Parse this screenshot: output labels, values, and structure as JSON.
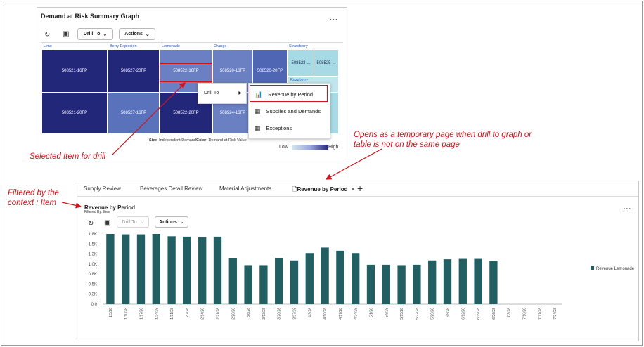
{
  "top": {
    "title": "Demand at Risk Summary Graph",
    "more": "...",
    "drill_label": "Drill To",
    "actions_label": "Actions",
    "categories": [
      "Lime",
      "Berry Explosion",
      "Lemonade",
      "Orange",
      "Strawberry",
      "Razzberry"
    ],
    "tiles": [
      "508521-16FP",
      "508527-20FP",
      "508522-16FP",
      "508520-16FP",
      "508520-20FP",
      "508523-...",
      "508525-...",
      "508521-20FP",
      "508527-16FP",
      "508522-20FP",
      "508524-16FP"
    ],
    "legend": {
      "size_label": "Size",
      "size_value": "Independent Demand",
      "color_label": "Color",
      "color_value": "Demand at Risk Value",
      "low": "Low",
      "high": "High"
    },
    "colors": {
      "dark": "#23277a",
      "mid": "#6a80c2",
      "light": "#a6dbe6"
    },
    "context_menu": {
      "drill_to": "Drill To"
    },
    "submenu": [
      "Revenue by Period",
      "Supplies and Demands",
      "Exceptions"
    ]
  },
  "annotations": {
    "selected": "Selected Item for drill",
    "opens": "Opens as a temporary page when drill to graph or table is not on the same page",
    "filtered": "Filtered by the context : Item"
  },
  "bottom": {
    "tabs": [
      "Supply Review",
      "Beverages Detail Review",
      "Material Adjustments",
      "Revenue by Period"
    ],
    "close": "×",
    "add": "+",
    "title": "Revenue by Period",
    "filter": "Filtered By: Item",
    "more": "...",
    "drill_label": "Drill To",
    "actions_label": "Actions"
  },
  "chart_data": {
    "type": "bar",
    "categories": [
      "1/3/28",
      "1/10/28",
      "1/17/28",
      "1/24/28",
      "1/31/28",
      "2/7/28",
      "2/14/28",
      "2/21/28",
      "2/28/28",
      "3/6/28",
      "3/13/28",
      "3/20/28",
      "3/27/28",
      "4/3/28",
      "4/10/28",
      "4/17/28",
      "4/24/28",
      "5/1/28",
      "5/8/28",
      "5/15/28",
      "5/22/28",
      "5/29/28",
      "6/5/28",
      "6/12/28",
      "6/19/28",
      "6/26/28",
      "7/3/28",
      "7/10/28",
      "7/17/28",
      "7/24/28"
    ],
    "series": [
      {
        "name": "Revenue Lemonade",
        "values": [
          1800,
          1790,
          1790,
          1800,
          1740,
          1730,
          1720,
          1730,
          1170,
          1000,
          1000,
          1180,
          1120,
          1310,
          1450,
          1370,
          1310,
          1010,
          1010,
          1000,
          1010,
          1120,
          1150,
          1160,
          1160,
          1110,
          0,
          0,
          0,
          0
        ]
      }
    ],
    "yticks": [
      "0.0",
      "0.3K",
      "0.5K",
      "0.8K",
      "1.0K",
      "1.3K",
      "1.5K",
      "1.8K"
    ],
    "ylim": [
      0,
      1800
    ],
    "bar_color": "#225f63"
  }
}
